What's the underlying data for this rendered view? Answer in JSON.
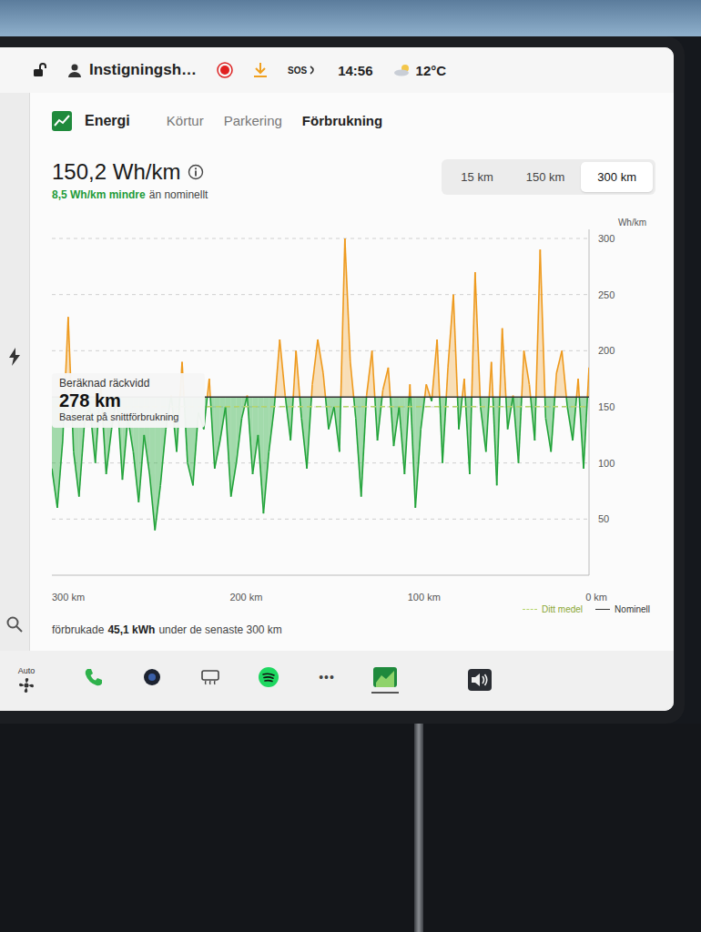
{
  "status_bar": {
    "profile": "Instigningsh…",
    "sos": "SOS",
    "time": "14:56",
    "temperature": "12°C"
  },
  "app": {
    "title": "Energi",
    "tabs": [
      {
        "label": "Körtur",
        "selected": false
      },
      {
        "label": "Parkering",
        "selected": false
      },
      {
        "label": "Förbrukning",
        "selected": true
      }
    ]
  },
  "summary": {
    "value": "150,2 Wh/km",
    "delta": "8,5 Wh/km mindre",
    "delta_suffix": "än nominellt"
  },
  "ranges": [
    {
      "label": "15 km",
      "selected": false
    },
    {
      "label": "150 km",
      "selected": false
    },
    {
      "label": "300 km",
      "selected": true
    }
  ],
  "chart": {
    "unit": "Wh/km",
    "y_ticks": [
      "300",
      "250",
      "200",
      "150",
      "100",
      "50"
    ],
    "x_ticks": [
      "300 km",
      "200 km",
      "100 km",
      "0 km"
    ],
    "legend": [
      {
        "label": "Ditt medel",
        "style": "dashed",
        "value": 150.2
      },
      {
        "label": "Nominell",
        "style": "solid",
        "value": 158.7
      }
    ],
    "series": [
      {
        "name": "Förbrukning",
        "values": [
          95,
          60,
          120,
          230,
          110,
          70,
          135,
          150,
          100,
          170,
          90,
          130,
          160,
          85,
          140,
          110,
          65,
          125,
          90,
          40,
          80,
          130,
          160,
          110,
          190,
          100,
          80,
          145,
          130,
          175,
          95,
          120,
          150,
          70,
          100,
          140,
          160,
          90,
          125,
          55,
          110,
          150,
          210,
          160,
          120,
          200,
          140,
          95,
          170,
          210,
          180,
          130,
          150,
          110,
          300,
          190,
          140,
          70,
          160,
          200,
          120,
          165,
          185,
          115,
          150,
          90,
          170,
          60,
          130,
          170,
          155,
          210,
          100,
          185,
          250,
          130,
          175,
          90,
          270,
          150,
          110,
          190,
          80,
          220,
          130,
          160,
          100,
          200,
          170,
          120,
          290,
          140,
          110,
          180,
          200,
          150,
          120,
          175,
          95,
          185
        ]
      }
    ]
  },
  "estimate": {
    "title": "Beräknad räckvidd",
    "value": "278 km",
    "note": "Baserat på snittförbrukning"
  },
  "footer": {
    "prefix": "förbrukade",
    "value": "45,1 kWh",
    "suffix": "under de senaste 300 km"
  },
  "taskbar": {
    "auto_label": "Auto",
    "items": [
      {
        "kind": "phone",
        "selected": false
      },
      {
        "kind": "camera",
        "selected": false
      },
      {
        "kind": "defrost",
        "selected": false
      },
      {
        "kind": "spotify",
        "selected": false
      },
      {
        "kind": "more",
        "label": "•••",
        "selected": false
      },
      {
        "kind": "energy",
        "selected": true
      }
    ]
  }
}
